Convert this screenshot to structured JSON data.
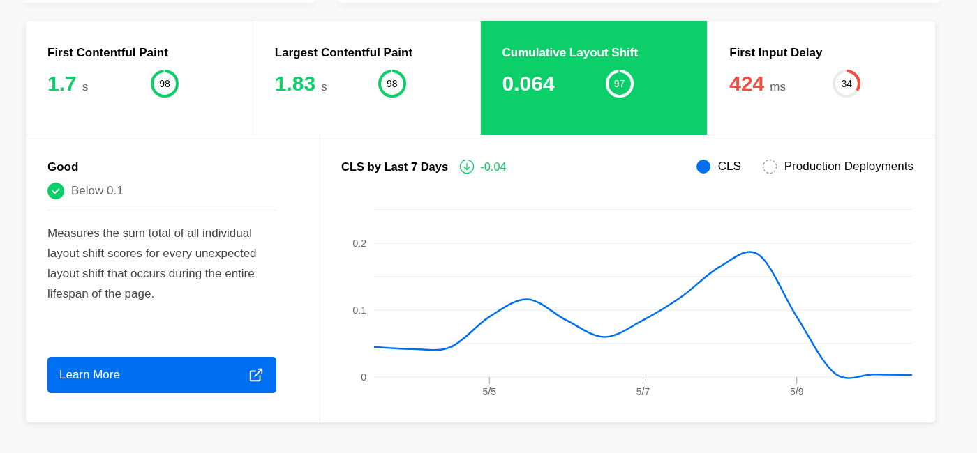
{
  "metrics": [
    {
      "title": "First Contentful Paint",
      "value": "1.7",
      "unit": "s",
      "score": "98",
      "level": 0.98,
      "color": "#0ccf6a",
      "selected": false
    },
    {
      "title": "Largest Contentful Paint",
      "value": "1.83",
      "unit": "s",
      "score": "98",
      "level": 0.98,
      "color": "#0ccf6a",
      "selected": false
    },
    {
      "title": "Cumulative Layout Shift",
      "value": "0.064",
      "score": "97",
      "level": 0.97,
      "color": "#0ccf6a",
      "selected": true
    },
    {
      "title": "First Input Delay",
      "value": "424",
      "unit": "ms",
      "score": "34",
      "level": 0.34,
      "color": "#f44c3f",
      "selected": false
    }
  ],
  "details": {
    "rating": "Good",
    "threshold": "Below 0.1",
    "description": "Measures the sum total of all individual layout shift scores for every unexpected layout shift that occurs during the entire lifespan of the page.",
    "button": "Learn More"
  },
  "chart": {
    "title": "CLS by Last 7 Days",
    "change": "-0.04",
    "legend": [
      {
        "label": "Production Deployments"
      }
    ],
    "chart_data": {
      "type": "line",
      "categories": [
        null,
        null,
        null,
        "5/5",
        null,
        null,
        null,
        "5/7",
        null,
        null,
        null,
        "5/9",
        null,
        null,
        null
      ],
      "series": [
        {
          "name": "CLS",
          "color": "#0070f3",
          "values": [
            0.045,
            0.042,
            0.045,
            0.09,
            0.116,
            0.085,
            0.06,
            0.085,
            0.12,
            0.165,
            0.183,
            0.09,
            0.005,
            0.004,
            0.003
          ]
        }
      ],
      "ylim": [
        0,
        0.25
      ],
      "yticks": [
        {
          "value": 0,
          "label": "0"
        },
        {
          "value": 0.1,
          "label": "0.1"
        },
        {
          "value": 0.2,
          "label": "0.2"
        }
      ]
    }
  }
}
